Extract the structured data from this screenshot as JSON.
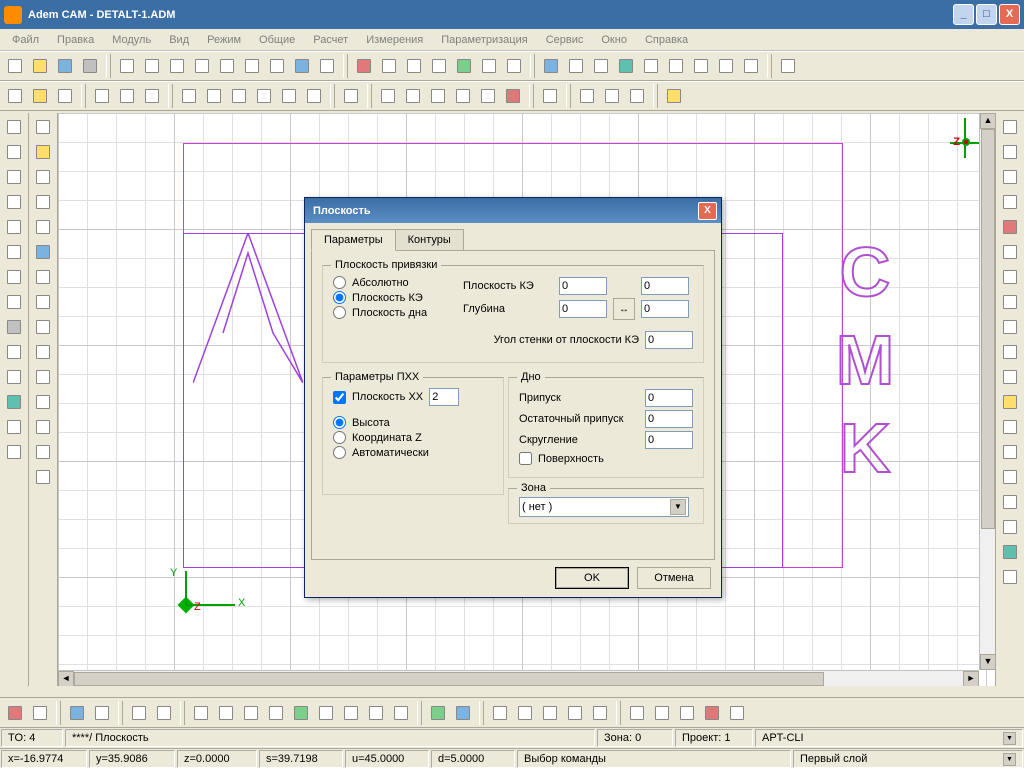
{
  "title": "Adem CAM - DETALT-1.ADM",
  "menu": [
    "Файл",
    "Правка",
    "Модуль",
    "Вид",
    "Режим",
    "Общие",
    "Расчет",
    "Измерения",
    "Параметризация",
    "Сервис",
    "Окно",
    "Справка"
  ],
  "dialog": {
    "title": "Плоскость",
    "tabs": {
      "params": "Параметры",
      "contours": "Контуры"
    },
    "binding_plane": {
      "title": "Плоскость привязки",
      "absolute": "Абсолютно",
      "plane_ke": "Плоскость КЭ",
      "plane_bottom": "Плоскость дна",
      "plane_ke_label": "Плоскость КЭ",
      "plane_ke_val1": "0",
      "plane_ke_val2": "0",
      "depth_label": "Глубина",
      "depth_val1": "0",
      "depth_val2": "0",
      "angle_label": "Угол стенки от плоскости КЭ",
      "angle_val": "0"
    },
    "pxx": {
      "title": "Параметры ПХХ",
      "plane_xx": "Плоскость XX",
      "plane_xx_val": "2",
      "height": "Высота",
      "coord_z": "Координата Z",
      "auto": "Автоматически"
    },
    "bottom": {
      "title": "Дно",
      "stock": "Припуск",
      "stock_val": "0",
      "rest_stock": "Остаточный припуск",
      "rest_stock_val": "0",
      "fillet": "Скругление",
      "fillet_val": "0",
      "surface": "Поверхность"
    },
    "zone": {
      "title": "Зона",
      "value": "( нет )"
    },
    "ok": "OK",
    "cancel": "Отмена"
  },
  "status1": {
    "to": "TO: 4",
    "path": "****/ Плоскость",
    "zone": "Зона: 0",
    "project": "Проект: 1",
    "apt": "APT-CLI"
  },
  "status2": {
    "x": "x=-16.9774",
    "y": "y=35.9086",
    "z": "z=0.0000",
    "s": "s=39.7198",
    "u": "u=45.0000",
    "d": "d=5.0000",
    "cmd": "Выбор команды",
    "layer": "Первый слой"
  },
  "axis_labels": {
    "x": "X",
    "y": "Y",
    "z": "Z"
  },
  "cmk": "CMK"
}
